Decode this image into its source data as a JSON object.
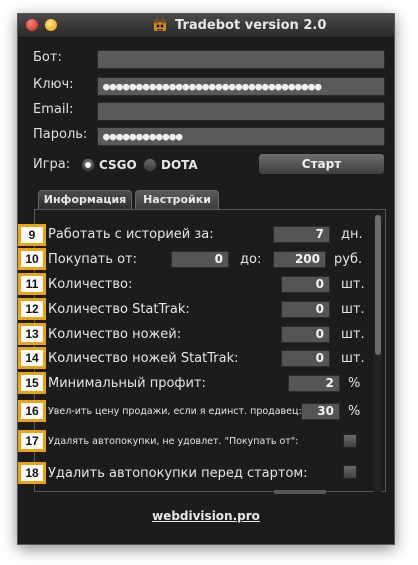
{
  "window": {
    "title": "Tradebot version 2.0"
  },
  "form": {
    "bot": {
      "label": "Бот:",
      "value": ""
    },
    "key": {
      "label": "Ключ:",
      "value": "●●●●●●●●●●●●●●●●●●●●●●●●●●●●●●●●●"
    },
    "email": {
      "label": "Email:",
      "value": ""
    },
    "password": {
      "label": "Пароль:",
      "value": "●●●●●●●●●●●●"
    },
    "game_label": "Игра:",
    "games": [
      {
        "label": "CSGO",
        "selected": true
      },
      {
        "label": "DOTA",
        "selected": false
      }
    ],
    "start_label": "Старт"
  },
  "tabs": [
    {
      "label": "Информация",
      "active": false
    },
    {
      "label": "Настройки",
      "active": true
    }
  ],
  "settings": [
    {
      "badge": "9",
      "label": "Работать с  историей за:",
      "value": "7",
      "unit": "дн."
    },
    {
      "badge": "10",
      "label": "Покупать от:",
      "value_from": "0",
      "mid_label": "до:",
      "value_to": "200",
      "unit": "руб."
    },
    {
      "badge": "11",
      "label": "Количество:",
      "value": "0",
      "unit": "шт."
    },
    {
      "badge": "12",
      "label": "Количество StatTrak:",
      "value": "0",
      "unit": "шт."
    },
    {
      "badge": "13",
      "label": "Количество ножей:",
      "value": "0",
      "unit": "шт."
    },
    {
      "badge": "14",
      "label": "Количество ножей StatTrak:",
      "value": "0",
      "unit": "шт."
    },
    {
      "badge": "15",
      "label": "Минимальный профит:",
      "value": "2",
      "unit": "%"
    },
    {
      "badge": "16",
      "label": "Увел-ить цену продажи, если я единст. продавец:",
      "value": "30",
      "unit": "%"
    },
    {
      "badge": "17",
      "label": "Удалять автопокупки, не удовлет. \"Покупать от\":",
      "checked": false
    },
    {
      "badge": "18",
      "label": "Удалить автопокупки перед стартом:",
      "checked": false
    }
  ],
  "footer": {
    "link": "webdivision.pro"
  },
  "colors": {
    "badge_border": "#e8a413",
    "window_bg": "#1c1c1c",
    "field_bg": "#5a5a5a"
  }
}
